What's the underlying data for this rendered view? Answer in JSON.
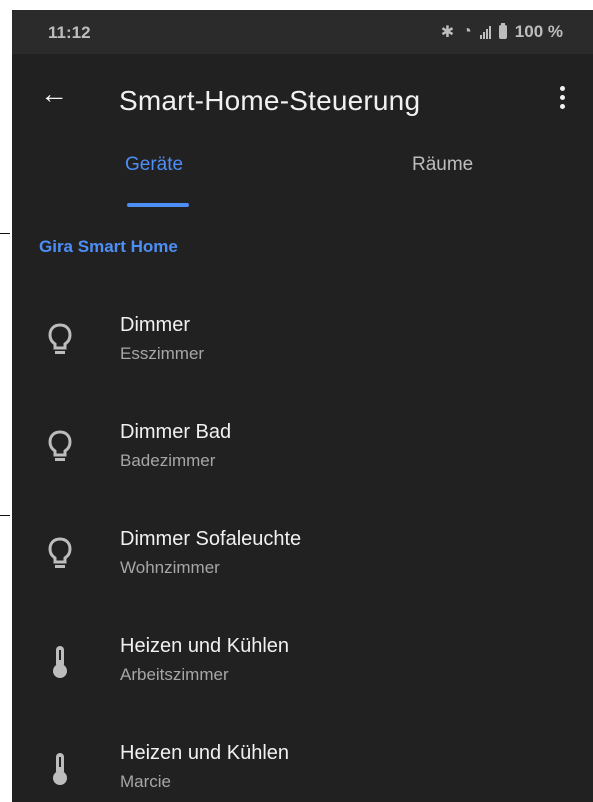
{
  "status": {
    "time": "11:12",
    "battery_text": "100 %"
  },
  "app_bar": {
    "title": "Smart-Home-Steuerung",
    "back_icon": "arrow-left-icon",
    "menu_icon": "more-vert-icon"
  },
  "tabs": [
    {
      "label": "Geräte",
      "selected": true
    },
    {
      "label": "Räume",
      "selected": false
    }
  ],
  "section": {
    "title": "Gira Smart Home"
  },
  "devices": [
    {
      "name": "Dimmer",
      "room": "Esszimmer",
      "icon": "lightbulb-icon"
    },
    {
      "name": "Dimmer Bad",
      "room": "Badezimmer",
      "icon": "lightbulb-icon"
    },
    {
      "name": "Dimmer Sofaleuchte",
      "room": "Wohnzimmer",
      "icon": "lightbulb-icon"
    },
    {
      "name": "Heizen und Kühlen",
      "room": "Arbeitszimmer",
      "icon": "thermometer-icon"
    },
    {
      "name": "Heizen und Kühlen",
      "room": "Marcie",
      "icon": "thermometer-icon"
    }
  ],
  "colors": {
    "background": "#212121",
    "accent": "#4e8ef7",
    "primary_text": "#f1f1f1",
    "secondary_text": "#a6a6a6"
  }
}
